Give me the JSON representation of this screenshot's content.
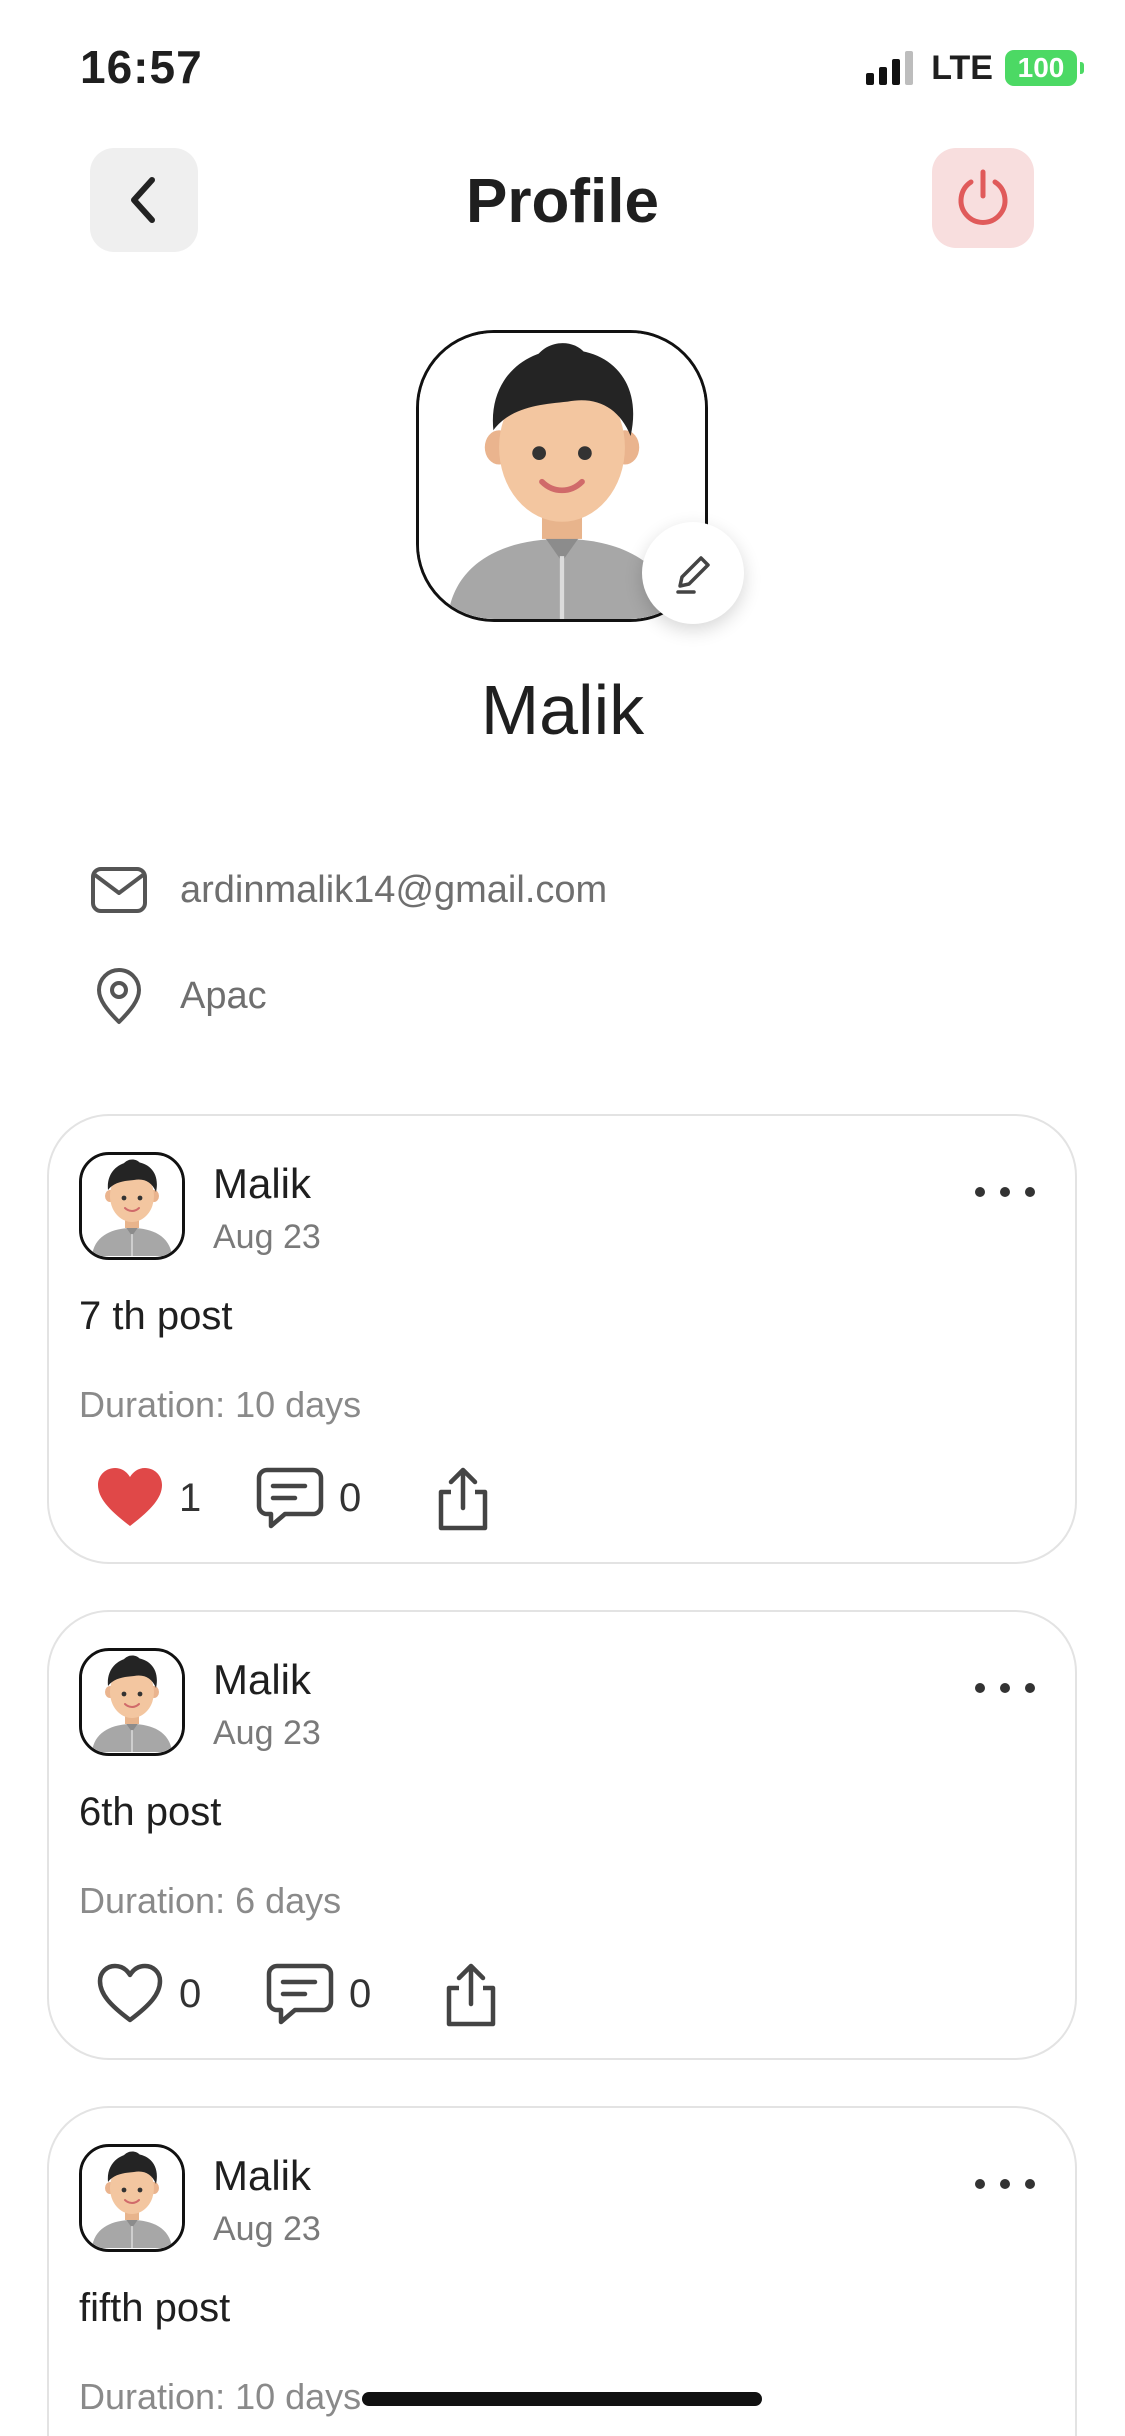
{
  "status_bar": {
    "time": "16:57",
    "network": "LTE",
    "battery": "100"
  },
  "header": {
    "title": "Profile"
  },
  "profile": {
    "name": "Malik",
    "email": "ardinmalik14@gmail.com",
    "location": "Apac"
  },
  "posts": [
    {
      "author": "Malik",
      "date": "Aug 23",
      "text": "7 th post",
      "duration": "Duration: 10 days",
      "likes": "1",
      "comments": "0",
      "liked": true
    },
    {
      "author": "Malik",
      "date": "Aug 23",
      "text": "6th post",
      "duration": "Duration: 6 days",
      "likes": "0",
      "comments": "0",
      "liked": false
    },
    {
      "author": "Malik",
      "date": "Aug 23",
      "text": "fifth post",
      "duration": "Duration: 10 days"
    }
  ],
  "colors": {
    "like_red": "#e04848",
    "power_red": "#e05a5a",
    "power_bg": "#f8dede",
    "battery_green": "#4cd964"
  }
}
